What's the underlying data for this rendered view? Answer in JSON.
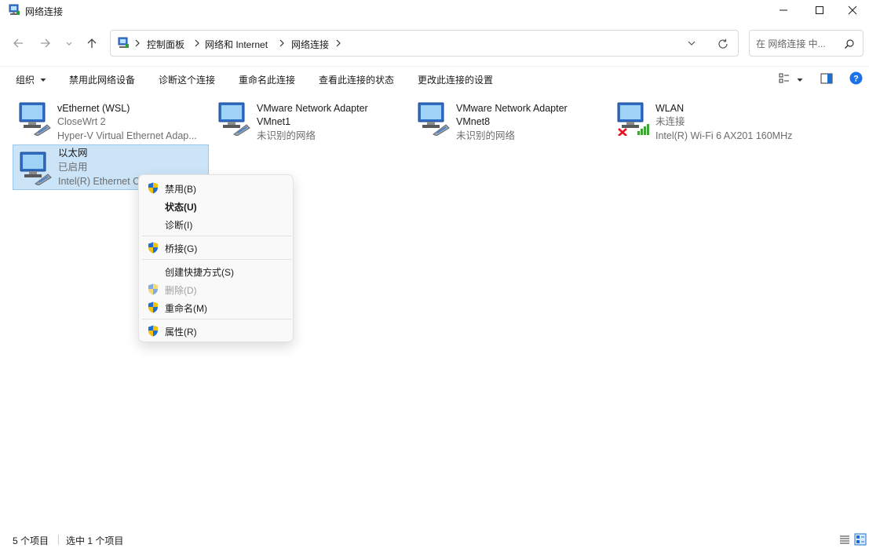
{
  "window": {
    "title": "网络连接",
    "icon": "network-connections-icon"
  },
  "navigation": {
    "breadcrumbs": [
      "控制面板",
      "网络和 Internet",
      "网络连接"
    ],
    "search_placeholder": "在 网络连接 中..."
  },
  "commands": [
    "组织",
    "禁用此网络设备",
    "诊断这个连接",
    "重命名此连接",
    "查看此连接的状态",
    "更改此连接的设置"
  ],
  "connections": [
    {
      "name": "vEthernet (WSL)",
      "line1": "CloseWrt 2",
      "line2": "Hyper-V Virtual Ethernet Adap...",
      "icon": "ethernet-adapter-icon",
      "selected": false
    },
    {
      "name": "VMware Network Adapter",
      "line1": "VMnet1",
      "line2": "未识别的网络",
      "icon": "ethernet-adapter-icon",
      "selected": false
    },
    {
      "name": "VMware Network Adapter",
      "line1": "VMnet8",
      "line2": "未识别的网络",
      "icon": "ethernet-adapter-icon",
      "selected": false
    },
    {
      "name": "WLAN",
      "line1": "未连接",
      "line2": "Intel(R) Wi-Fi 6 AX201 160MHz",
      "icon": "wlan-disconnected-icon",
      "selected": false
    },
    {
      "name": "以太网",
      "line1": "已启用",
      "line2": "Intel(R) Ethernet C",
      "icon": "ethernet-adapter-icon",
      "selected": true
    }
  ],
  "context_menu": [
    {
      "label": "禁用(B)",
      "shield": true,
      "bold": false,
      "disabled": false
    },
    {
      "label": "状态(U)",
      "shield": false,
      "bold": true,
      "disabled": false
    },
    {
      "label": "诊断(I)",
      "shield": false,
      "bold": false,
      "disabled": false
    },
    {
      "label": "桥接(G)",
      "shield": true,
      "bold": false,
      "disabled": false
    },
    {
      "label": "创建快捷方式(S)",
      "shield": false,
      "bold": false,
      "disabled": false
    },
    {
      "label": "删除(D)",
      "shield": true,
      "bold": false,
      "disabled": true
    },
    {
      "label": "重命名(M)",
      "shield": true,
      "bold": false,
      "disabled": false
    },
    {
      "label": "属性(R)",
      "shield": true,
      "bold": false,
      "disabled": false
    }
  ],
  "status": {
    "item_count": "5 个项目",
    "selected_count": "选中 1 个项目"
  },
  "colors": {
    "selection_bg": "#cce4f7",
    "selection_border": "#99c9ef",
    "help_blue": "#1a73e8",
    "shield_blue": "#1f6fd1",
    "shield_yellow": "#f4c20d",
    "error_red": "#e81123",
    "signal_green": "#3fa535"
  }
}
